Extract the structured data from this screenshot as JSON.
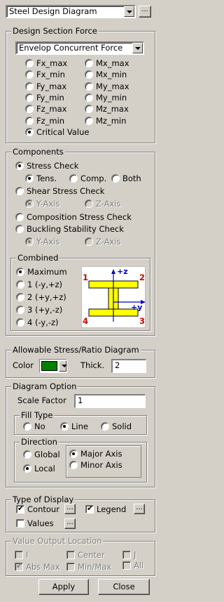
{
  "diagram_select": {
    "value": "Steel Design Diagram",
    "more_label": "..."
  },
  "design_section_force": {
    "title": "Design Section Force",
    "select_value": "Envelop Concurrent Force",
    "options": [
      "Fx_max",
      "Mx_max",
      "Fx_min",
      "Mx_min",
      "Fy_max",
      "My_max",
      "Fy_min",
      "My_min",
      "Fz_max",
      "Mz_max",
      "Fz_min",
      "Mz_min",
      "Critical Value"
    ],
    "selected": "Critical Value"
  },
  "components": {
    "title": "Components",
    "stress_check": "Stress Check",
    "tens": "Tens.",
    "comp": "Comp.",
    "both": "Both",
    "shear_stress_check": "Shear Stress Check",
    "shear_y": "Y-Axis",
    "shear_z": "Z-Axis",
    "composition_stress_check": "Composition Stress Check",
    "buckling_stability_check": "Buckling Stability Check",
    "buck_y": "Y-Axis",
    "buck_z": "Z-Axis",
    "combined": {
      "title": "Combined",
      "options": [
        "Maximum",
        "1 (-y,+z)",
        "2 (+y,+z)",
        "3 (+y,-z)",
        "4 (-y,-z)"
      ],
      "selected": "Maximum"
    },
    "section_diagram": {
      "corner_labels": [
        "1",
        "2",
        "3",
        "4"
      ],
      "axis_z": "+z",
      "axis_y": "+y",
      "flange_color": "#ffff00",
      "label_color": "#cc0000",
      "axis_color": "#0000cc"
    }
  },
  "allowable": {
    "title": "Allowable Stress/Ratio Diagram",
    "color_label": "Color",
    "color_value": "#008000",
    "thick_label": "Thick.",
    "thick_value": "2"
  },
  "diagram_option": {
    "title": "Diagram Option",
    "scale_label": "Scale Factor",
    "scale_value": "1",
    "fill_type": {
      "title": "Fill Type",
      "no": "No",
      "line": "Line",
      "solid": "Solid",
      "selected": "Line"
    },
    "direction": {
      "title": "Direction",
      "global": "Global",
      "local": "Local",
      "major": "Major Axis",
      "minor": "Minor Axis",
      "selected": "Local",
      "axis_selected": "Major Axis"
    }
  },
  "type_of_display": {
    "title": "Type of Display",
    "contour": "Contour",
    "legend": "Legend",
    "values": "Values",
    "more_label": "..."
  },
  "value_output_location": {
    "title": "Value Output Location",
    "i": "I",
    "center": "Center",
    "j": "J",
    "abs_max": "Abs Max",
    "min_max": "Min/Max",
    "all": "All"
  },
  "buttons": {
    "apply": "Apply",
    "close": "Close"
  }
}
